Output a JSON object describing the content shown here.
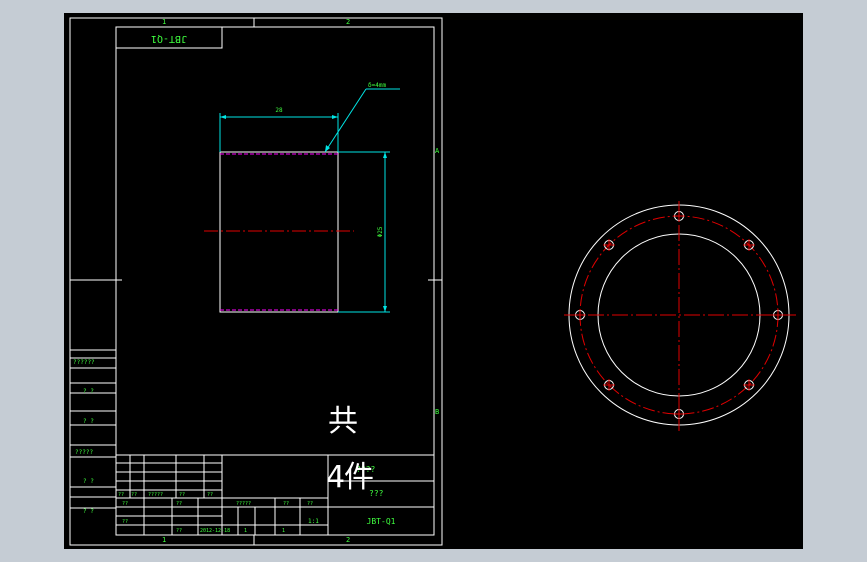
{
  "drawing": {
    "code": "JBT-Q1",
    "code_mirrored": "JBT-Q1",
    "zone_top_1": "1",
    "zone_top_2": "2",
    "zone_bottom_1": "1",
    "zone_bottom_2": "2",
    "zone_right_a": "A",
    "zone_right_b": "B",
    "total_pieces": "共",
    "piece_label": "件",
    "piece_num": "4",
    "dim_width": "28",
    "dim_height": "Φ25",
    "thickness_note": "δ=4mm"
  },
  "side_labels": [
    "??????",
    "? ?",
    "? ?",
    "?????",
    "? ?",
    "? ?"
  ],
  "title_block": {
    "cells_a": [
      "??",
      "??",
      "?????",
      "??",
      "??"
    ],
    "cells_b": [
      "??",
      "??"
    ],
    "cells_c": [
      "??",
      "??",
      "2012-12-18"
    ],
    "name_row": "?????",
    "mid_a": "??",
    "mid_b": "??",
    "mid_c": "1:1",
    "sheet_a": "1",
    "sheet_b": "1",
    "title": "????",
    "subtitle": "???"
  },
  "colors": {
    "background": "#000000",
    "frame": "#ffffff",
    "dimension": "#00e5e5",
    "centerline": "#e00000",
    "hidden_edge": "#ff00ff",
    "text": "#3fff3f"
  }
}
